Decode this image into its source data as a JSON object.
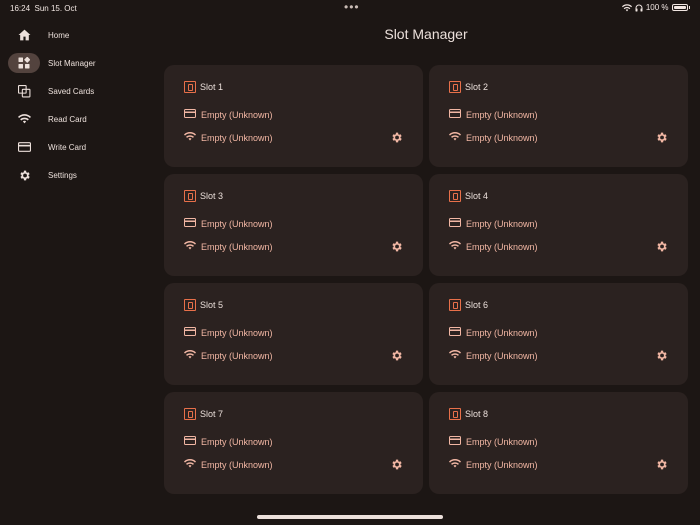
{
  "status_bar": {
    "time": "16:24",
    "date": "Sun 15. Oct",
    "battery": "100 %"
  },
  "nav": {
    "items": [
      {
        "label": "Home",
        "icon": "home-icon"
      },
      {
        "label": "Slot Manager",
        "icon": "grid-icon",
        "active": true
      },
      {
        "label": "Saved Cards",
        "icon": "copy-icon"
      },
      {
        "label": "Read Card",
        "icon": "wifi-icon"
      },
      {
        "label": "Write Card",
        "icon": "card-icon"
      },
      {
        "label": "Settings",
        "icon": "gear-icon"
      }
    ]
  },
  "page": {
    "title": "Slot Manager"
  },
  "slots": [
    {
      "name": "Slot 1",
      "hf": "Empty (Unknown)",
      "lf": "Empty (Unknown)"
    },
    {
      "name": "Slot 2",
      "hf": "Empty (Unknown)",
      "lf": "Empty (Unknown)"
    },
    {
      "name": "Slot 3",
      "hf": "Empty (Unknown)",
      "lf": "Empty (Unknown)"
    },
    {
      "name": "Slot 4",
      "hf": "Empty (Unknown)",
      "lf": "Empty (Unknown)"
    },
    {
      "name": "Slot 5",
      "hf": "Empty (Unknown)",
      "lf": "Empty (Unknown)"
    },
    {
      "name": "Slot 6",
      "hf": "Empty (Unknown)",
      "lf": "Empty (Unknown)"
    },
    {
      "name": "Slot 7",
      "hf": "Empty (Unknown)",
      "lf": "Empty (Unknown)"
    },
    {
      "name": "Slot 8",
      "hf": "Empty (Unknown)",
      "lf": "Empty (Unknown)"
    }
  ],
  "colors": {
    "background": "#1c1614",
    "card": "#2b2220",
    "accent": "#e8704a",
    "muted_accent": "#f2b7a4",
    "active_pill": "#53433e"
  }
}
